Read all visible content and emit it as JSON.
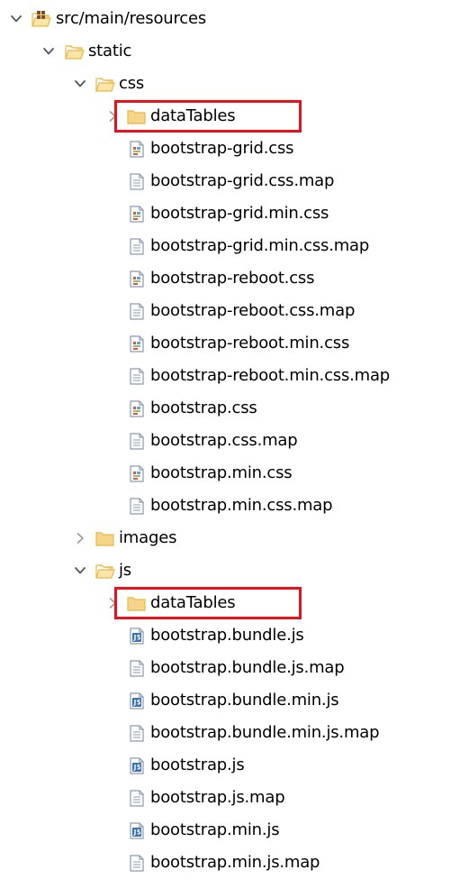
{
  "tree": [
    {
      "label": "src/main/resources",
      "level": 0,
      "kind": "package-folder",
      "state": "expanded"
    },
    {
      "label": "static",
      "level": 1,
      "kind": "folder-open",
      "state": "expanded"
    },
    {
      "label": "css",
      "level": 2,
      "kind": "folder-open",
      "state": "expanded"
    },
    {
      "label": "dataTables",
      "level": 3,
      "kind": "folder",
      "state": "collapsed",
      "highlighted": true
    },
    {
      "label": "bootstrap-grid.css",
      "level": 3,
      "kind": "css-file"
    },
    {
      "label": "bootstrap-grid.css.map",
      "level": 3,
      "kind": "text-file"
    },
    {
      "label": "bootstrap-grid.min.css",
      "level": 3,
      "kind": "css-file"
    },
    {
      "label": "bootstrap-grid.min.css.map",
      "level": 3,
      "kind": "text-file"
    },
    {
      "label": "bootstrap-reboot.css",
      "level": 3,
      "kind": "css-file"
    },
    {
      "label": "bootstrap-reboot.css.map",
      "level": 3,
      "kind": "text-file"
    },
    {
      "label": "bootstrap-reboot.min.css",
      "level": 3,
      "kind": "css-file"
    },
    {
      "label": "bootstrap-reboot.min.css.map",
      "level": 3,
      "kind": "text-file"
    },
    {
      "label": "bootstrap.css",
      "level": 3,
      "kind": "css-file"
    },
    {
      "label": "bootstrap.css.map",
      "level": 3,
      "kind": "text-file"
    },
    {
      "label": "bootstrap.min.css",
      "level": 3,
      "kind": "css-file"
    },
    {
      "label": "bootstrap.min.css.map",
      "level": 3,
      "kind": "text-file"
    },
    {
      "label": "images",
      "level": 2,
      "kind": "folder",
      "state": "collapsed"
    },
    {
      "label": "js",
      "level": 2,
      "kind": "folder-open",
      "state": "expanded"
    },
    {
      "label": "dataTables",
      "level": 3,
      "kind": "folder",
      "state": "collapsed",
      "highlighted": true
    },
    {
      "label": "bootstrap.bundle.js",
      "level": 3,
      "kind": "js-file"
    },
    {
      "label": "bootstrap.bundle.js.map",
      "level": 3,
      "kind": "text-file"
    },
    {
      "label": "bootstrap.bundle.min.js",
      "level": 3,
      "kind": "js-file"
    },
    {
      "label": "bootstrap.bundle.min.js.map",
      "level": 3,
      "kind": "text-file"
    },
    {
      "label": "bootstrap.js",
      "level": 3,
      "kind": "js-file"
    },
    {
      "label": "bootstrap.js.map",
      "level": 3,
      "kind": "text-file"
    },
    {
      "label": "bootstrap.min.js",
      "level": 3,
      "kind": "js-file"
    },
    {
      "label": "bootstrap.min.js.map",
      "level": 3,
      "kind": "text-file"
    }
  ],
  "colors": {
    "highlight": "#e8131a",
    "folder": "#e8b84a",
    "chevron": "#555555"
  },
  "icons": {
    "package-folder": "package-folder-icon",
    "folder": "folder-icon",
    "folder-open": "open-folder-icon",
    "css-file": "css-file-icon",
    "text-file": "text-file-icon",
    "js-file": "js-file-icon"
  }
}
